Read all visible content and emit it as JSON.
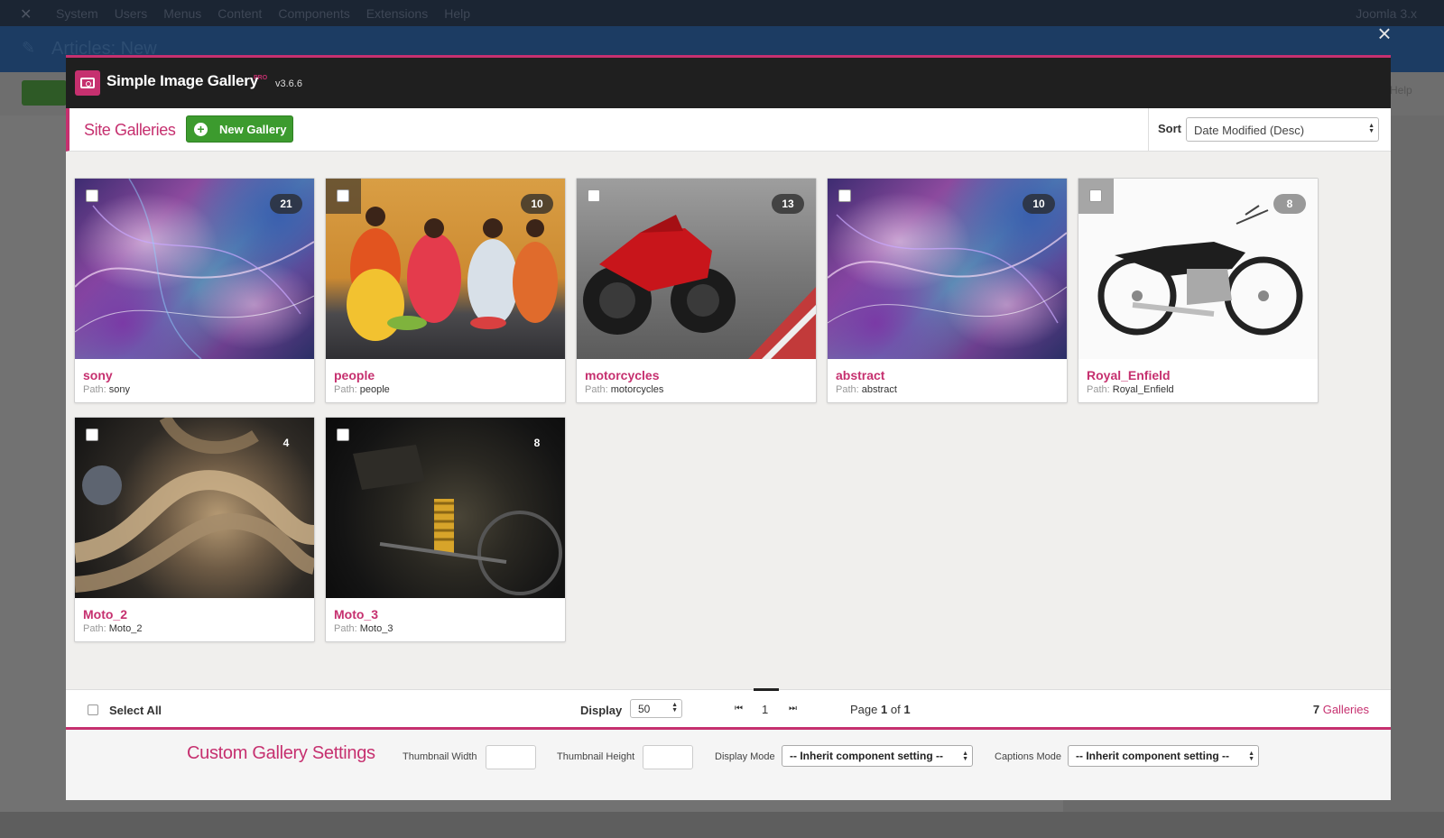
{
  "background": {
    "menu": [
      "System",
      "Users",
      "Menus",
      "Content",
      "Components",
      "Extensions",
      "Help"
    ],
    "right_label": "Joomla 3.x",
    "page_title": "Articles: New",
    "help": "Help"
  },
  "modal": {
    "title": "Simple Image Gallery",
    "pro_badge": "PRO",
    "version": "v3.6.6",
    "section_title": "Site Galleries",
    "new_gallery_label": "New Gallery",
    "sort_label": "Sort",
    "sort_value": "Date Modified (Desc)"
  },
  "galleries": [
    {
      "name": "sony",
      "path_label": "Path:",
      "path": "sony",
      "count": "21"
    },
    {
      "name": "people",
      "path_label": "Path:",
      "path": "people",
      "count": "10"
    },
    {
      "name": "motorcycles",
      "path_label": "Path:",
      "path": "motorcycles",
      "count": "13"
    },
    {
      "name": "abstract",
      "path_label": "Path:",
      "path": "abstract",
      "count": "10"
    },
    {
      "name": "Royal_Enfield",
      "path_label": "Path:",
      "path": "Royal_Enfield",
      "count": "8"
    },
    {
      "name": "Moto_2",
      "path_label": "Path:",
      "path": "Moto_2",
      "count": "4"
    },
    {
      "name": "Moto_3",
      "path_label": "Path:",
      "path": "Moto_3",
      "count": "8"
    }
  ],
  "footer": {
    "select_all": "Select All",
    "display_label": "Display",
    "display_value": "50",
    "current_page": "1",
    "page_word": "Page",
    "page_current": "1",
    "of_word": "of",
    "page_total": "1",
    "gallery_count": "7",
    "gallery_word": "Galleries"
  },
  "settings": {
    "title": "Custom Gallery Settings",
    "thumb_width_label": "Thumbnail Width",
    "thumb_height_label": "Thumbnail Height",
    "display_mode_label": "Display Mode",
    "display_mode_value": "-- Inherit component setting --",
    "captions_mode_label": "Captions Mode",
    "captions_mode_value": "-- Inherit component setting --"
  },
  "colors": {
    "accent": "#c6306f",
    "primary_button": "#3c9b2e",
    "header_bg": "#1f1f1f"
  }
}
